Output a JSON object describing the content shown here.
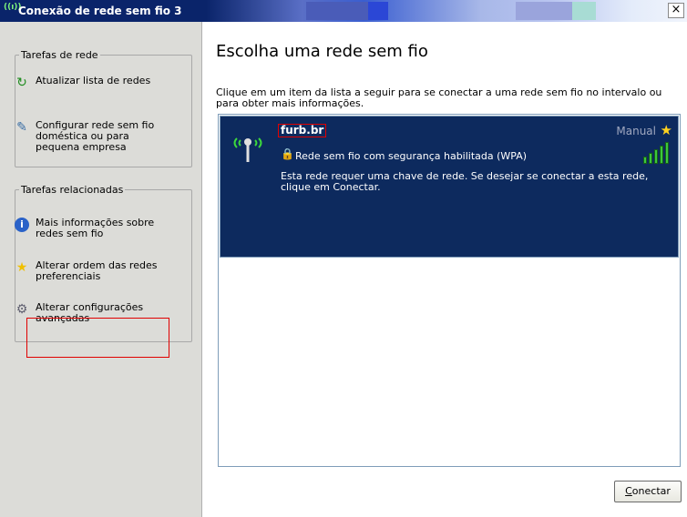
{
  "window": {
    "title": "Conexão de rede sem fio 3",
    "close_glyph": "×",
    "title_icon": "wireless-network-icon"
  },
  "sidebar": {
    "network_tasks": {
      "title": "Tarefas de rede",
      "items": [
        {
          "label": "Atualizar lista de redes",
          "icon": "refresh-icon"
        },
        {
          "label": "Configurar rede sem fio doméstica ou para pequena empresa",
          "icon": "setup-wizard-icon"
        }
      ]
    },
    "related_tasks": {
      "title": "Tarefas relacionadas",
      "items": [
        {
          "label": "Mais informações sobre redes sem fio",
          "icon": "info-icon"
        },
        {
          "label": "Alterar ordem das redes preferenciais",
          "icon": "star-icon"
        },
        {
          "label": "Alterar configurações avançadas",
          "icon": "advanced-settings-icon"
        }
      ]
    }
  },
  "main": {
    "heading": "Escolha uma rede sem fio",
    "intro": "Clique em um item da lista a seguir para se conectar a uma rede sem fio no intervalo ou para obter mais informações.",
    "networks": [
      {
        "ssid": "furb.br",
        "connection_type": "Manual",
        "security": "Rede sem fio com segurança habilitada (WPA)",
        "description": "Esta rede requer uma chave de rede. Se desejar se conectar a esta rede, clique em Conectar.",
        "signal_bars": 5,
        "preferred": true
      }
    ],
    "connect_label_prefix": "C",
    "connect_label_rest": "onectar"
  },
  "colors": {
    "title_bar": "#0a246a",
    "sidebar_bg": "#dcdcd8",
    "selected_item_bg": "#0d2a5e",
    "highlight_border": "#e00000",
    "signal_green": "#3cc83c"
  }
}
